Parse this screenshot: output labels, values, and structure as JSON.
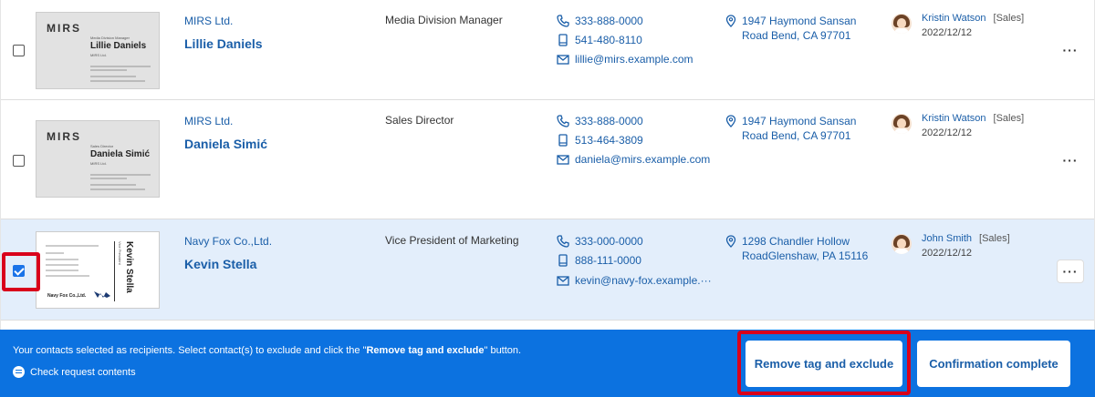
{
  "contacts": [
    {
      "checked": false,
      "company": "MIRS Ltd.",
      "name": "Lillie Daniels",
      "title": "Media Division Manager",
      "phone": "333-888-0000",
      "mobile": "541-480-8110",
      "email": "lillie@mirs.example.com",
      "address": "1947 Haymond Sansan Road Bend, CA 97701",
      "owner": "Kristin Watson",
      "owner_dept": "[Sales]",
      "date": "2022/12/12",
      "card": {
        "brand": "MIRS",
        "card_title": "Media Division Manager",
        "card_name": "Lillie Daniels",
        "card_company": "MIRS Ltd."
      }
    },
    {
      "checked": false,
      "company": "MIRS Ltd.",
      "name": "Daniela Simić",
      "title": "Sales Director",
      "phone": "333-888-0000",
      "mobile": "513-464-3809",
      "email": "daniela@mirs.example.com",
      "address": "1947 Haymond Sansan Road Bend, CA 97701",
      "owner": "Kristin Watson",
      "owner_dept": "[Sales]",
      "date": "2022/12/12",
      "card": {
        "brand": "MIRS",
        "card_title": "Sales Director",
        "card_name": "Daniela Simić",
        "card_company": "MIRS Ltd."
      }
    },
    {
      "checked": true,
      "company": "Navy Fox Co.,Ltd.",
      "name": "Kevin Stella",
      "title": "Vice President of Marketing",
      "phone": "333-000-0000",
      "mobile": "888-111-0000",
      "email": "kevin@navy-fox.example.···",
      "address": "1298 Chandler Hollow RoadGlenshaw, PA 15116",
      "owner": "John Smith",
      "owner_dept": "[Sales]",
      "date": "2022/12/12",
      "card": {
        "card_name": "Kevin Stella",
        "card_company": "Navy Fox Co.,Ltd."
      }
    }
  ],
  "more_icon": "more-horizontal-icon",
  "bar": {
    "message_pre": "Your contacts selected as recipients. Select contact(s) to exclude and click the \"",
    "message_bold": "Remove tag and exclude",
    "message_post": "\" button.",
    "request_link": "Check request contents",
    "remove_button": "Remove tag and exclude",
    "confirm_button": "Confirmation complete"
  },
  "colors": {
    "accent": "#0c72e0",
    "link": "#1a5ea8",
    "highlight": "#d9001b",
    "selected_row": "#e3eefb"
  }
}
